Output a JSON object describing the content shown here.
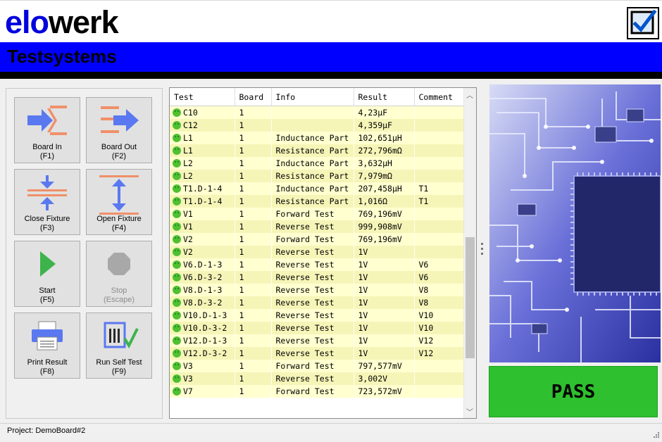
{
  "header": {
    "logo_part1": "elo",
    "logo_part2": "werk",
    "subtitle": "Testsystems"
  },
  "buttons": [
    {
      "name": "Board In",
      "key": "(F1)"
    },
    {
      "name": "Board Out",
      "key": "(F2)"
    },
    {
      "name": "Close Fixture",
      "key": "(F3)"
    },
    {
      "name": "Open Fixture",
      "key": "(F4)"
    },
    {
      "name": "Start",
      "key": "(F5)"
    },
    {
      "name": "Stop",
      "key": "(Escape)"
    },
    {
      "name": "Print Result",
      "key": "(F8)"
    },
    {
      "name": "Run Self Test",
      "key": "(F9)"
    }
  ],
  "grid": {
    "columns": [
      "Test",
      "Board",
      "Info",
      "Result",
      "Comment"
    ],
    "rows": [
      [
        "C10",
        "1",
        "",
        "4,23µF",
        ""
      ],
      [
        "C12",
        "1",
        "",
        "4,359µF",
        ""
      ],
      [
        "L1",
        "1",
        "Inductance Part",
        "102,651µH",
        ""
      ],
      [
        "L1",
        "1",
        "Resistance Part",
        "272,796mΩ",
        ""
      ],
      [
        "L2",
        "1",
        "Inductance Part",
        "3,632µH",
        ""
      ],
      [
        "L2",
        "1",
        "Resistance Part",
        "7,979mΩ",
        ""
      ],
      [
        "T1.D-1-4",
        "1",
        "Inductance Part",
        "207,458µH",
        "T1"
      ],
      [
        "T1.D-1-4",
        "1",
        "Resistance Part",
        "1,016Ω",
        "T1"
      ],
      [
        "V1",
        "1",
        "Forward Test",
        "769,196mV",
        ""
      ],
      [
        "V1",
        "1",
        "Reverse Test",
        "999,908mV",
        ""
      ],
      [
        "V2",
        "1",
        "Forward Test",
        "769,196mV",
        ""
      ],
      [
        "V2",
        "1",
        "Reverse Test",
        "1V",
        ""
      ],
      [
        "V6.D-1-3",
        "1",
        "Reverse Test",
        "1V",
        "V6"
      ],
      [
        "V6.D-3-2",
        "1",
        "Reverse Test",
        "1V",
        "V6"
      ],
      [
        "V8.D-1-3",
        "1",
        "Reverse Test",
        "1V",
        "V8"
      ],
      [
        "V8.D-3-2",
        "1",
        "Reverse Test",
        "1V",
        "V8"
      ],
      [
        "V10.D-1-3",
        "1",
        "Reverse Test",
        "1V",
        "V10"
      ],
      [
        "V10.D-3-2",
        "1",
        "Reverse Test",
        "1V",
        "V10"
      ],
      [
        "V12.D-1-3",
        "1",
        "Reverse Test",
        "1V",
        "V12"
      ],
      [
        "V12.D-3-2",
        "1",
        "Reverse Test",
        "1V",
        "V12"
      ],
      [
        "V3",
        "1",
        "Forward Test",
        "797,577mV",
        ""
      ],
      [
        "V3",
        "1",
        "Reverse Test",
        "3,002V",
        ""
      ],
      [
        "V7",
        "1",
        "Forward Test",
        "723,572mV",
        ""
      ]
    ]
  },
  "result": {
    "label": "PASS",
    "color": "#2ec02e"
  },
  "status": {
    "text": "Project: DemoBoard#2"
  },
  "colors": {
    "brand_blue": "#0000ff",
    "icon_blue": "#5a78f0",
    "icon_orange": "#f0906a",
    "row_odd": "#ffffd0",
    "row_even": "#f5f5b8"
  }
}
